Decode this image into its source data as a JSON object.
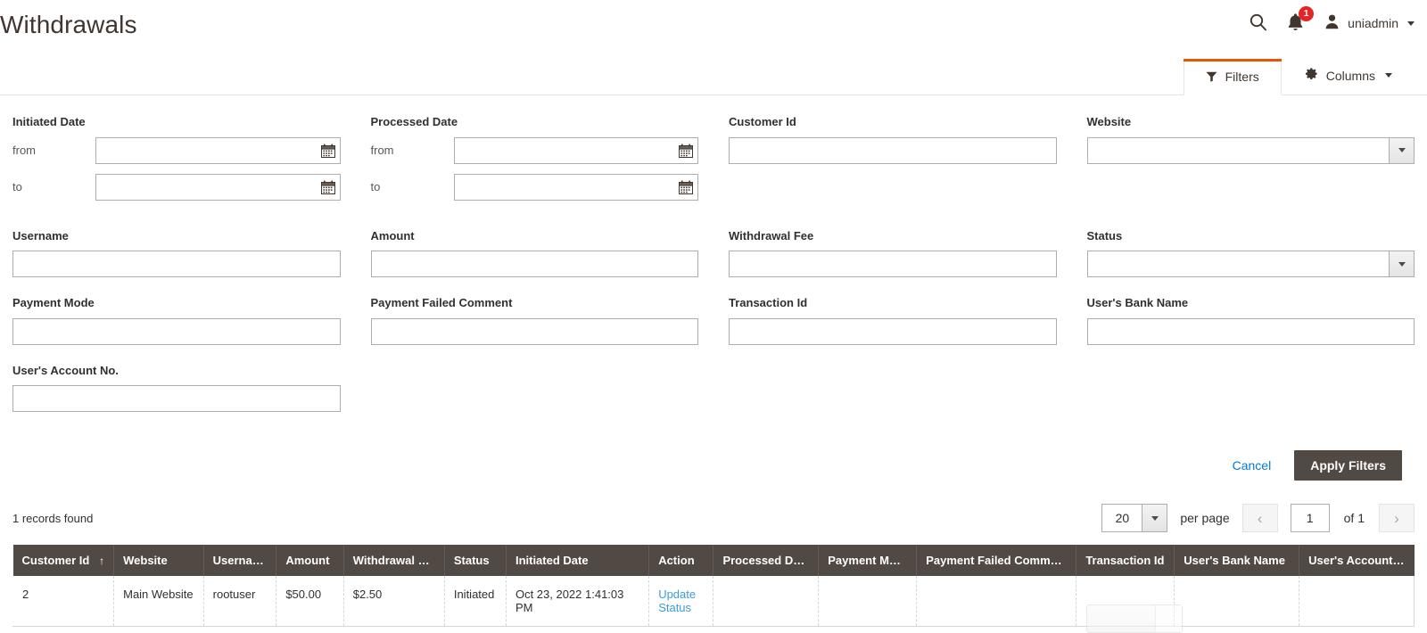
{
  "header": {
    "title": "Withdrawals",
    "search_icon": "search-icon",
    "notifications_icon": "bell-icon",
    "notifications_count": "1",
    "user_icon": "user-icon",
    "user_name": "uniadmin"
  },
  "tabs": [
    {
      "label": "Filters",
      "icon": "funnel-icon",
      "active": true
    },
    {
      "label": "Columns",
      "icon": "gear-icon",
      "active": false,
      "has_caret": true
    }
  ],
  "filters": {
    "initiated_date": {
      "label": "Initiated Date",
      "from_label": "from",
      "to_label": "to",
      "from_value": "",
      "to_value": ""
    },
    "processed_date": {
      "label": "Processed Date",
      "from_label": "from",
      "to_label": "to",
      "from_value": "",
      "to_value": ""
    },
    "customer_id": {
      "label": "Customer Id",
      "value": ""
    },
    "website": {
      "label": "Website",
      "value": "",
      "options": [
        ""
      ]
    },
    "username": {
      "label": "Username",
      "value": ""
    },
    "amount": {
      "label": "Amount",
      "value": ""
    },
    "withdrawal_fee": {
      "label": "Withdrawal Fee",
      "value": ""
    },
    "status": {
      "label": "Status",
      "value": "",
      "options": [
        ""
      ]
    },
    "payment_mode": {
      "label": "Payment Mode",
      "value": ""
    },
    "payment_failed_comment": {
      "label": "Payment Failed Comment",
      "value": ""
    },
    "transaction_id": {
      "label": "Transaction Id",
      "value": ""
    },
    "users_bank_name": {
      "label": "User's Bank Name",
      "value": ""
    },
    "users_account_no": {
      "label": "User's Account No.",
      "value": ""
    },
    "cancel_label": "Cancel",
    "apply_label": "Apply Filters"
  },
  "toolbar": {
    "records_found": "1 records found",
    "per_page_value": "20",
    "per_page_label": "per page",
    "prev_label": "‹",
    "next_label": "›",
    "current_page": "1",
    "of_pages": "of 1"
  },
  "grid": {
    "columns": [
      {
        "label": "Customer Id",
        "sorted": "asc",
        "sort_glyph": "↑",
        "width": "7.2%"
      },
      {
        "label": "Website",
        "width": "6.4%"
      },
      {
        "label": "Username",
        "width": "5.2%"
      },
      {
        "label": "Amount",
        "width": "4.8%"
      },
      {
        "label": "Withdrawal Fee",
        "width": "7.2%"
      },
      {
        "label": "Status",
        "width": "4.4%"
      },
      {
        "label": "Initiated Date",
        "width": "10.2%"
      },
      {
        "label": "Action",
        "width": "4.6%"
      },
      {
        "label": "Processed Date",
        "width": "7.5%"
      },
      {
        "label": "Payment Mode",
        "width": "7.0%"
      },
      {
        "label": "Payment Failed Comment",
        "width": "11.4%"
      },
      {
        "label": "Transaction Id",
        "width": "7.0%"
      },
      {
        "label": "User's Bank Name",
        "width": "8.9%"
      },
      {
        "label": "User's Account No.",
        "width": "8.2%"
      }
    ],
    "rows": [
      {
        "customer_id": "2",
        "website": "Main Website",
        "username": "rootuser",
        "amount": "$50.00",
        "withdrawal_fee": "$2.50",
        "status": "Initiated",
        "initiated_date": "Oct 23, 2022 1:41:03 PM",
        "action": "Update Status",
        "processed_date": "",
        "payment_mode": "",
        "payment_failed_comment": "",
        "transaction_id": "",
        "users_bank_name": "",
        "users_account_no": ""
      }
    ]
  },
  "colors": {
    "accent_orange": "#eb5202",
    "header_brown": "#514943",
    "link_blue": "#007bdb",
    "cell_link_blue": "#3b9cd9",
    "badge_red": "#e22626"
  }
}
